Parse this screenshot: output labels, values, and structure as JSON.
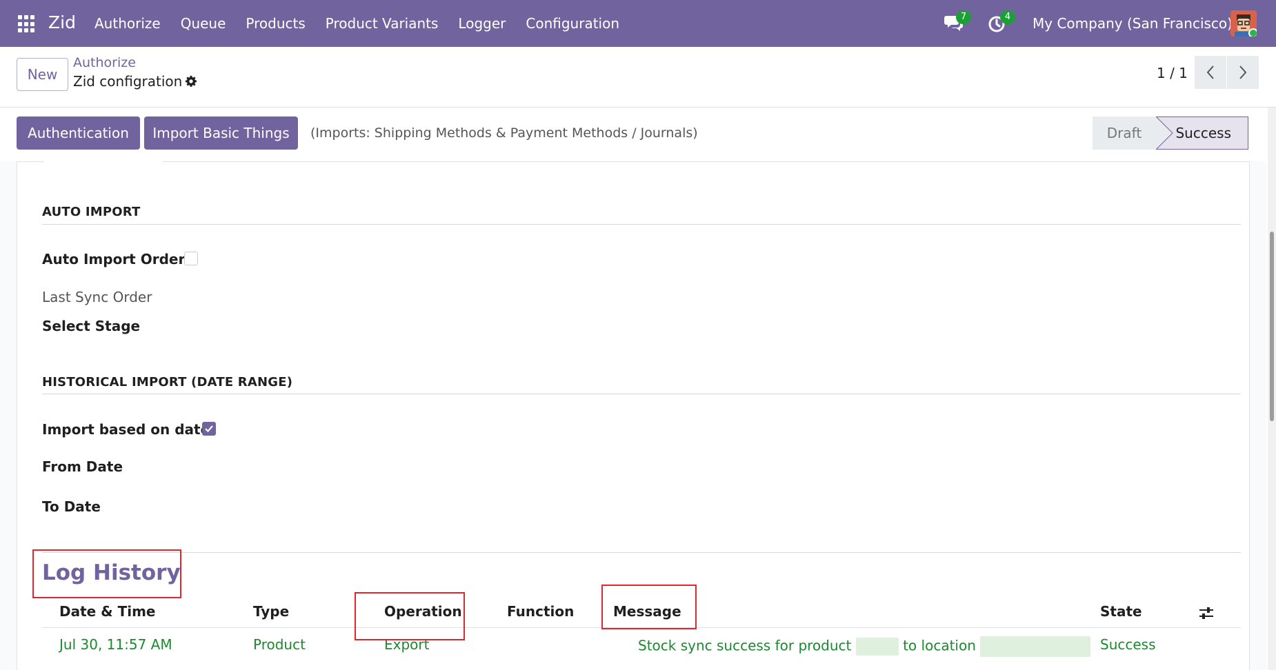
{
  "navbar": {
    "brand": "Zid",
    "menu": [
      "Authorize",
      "Queue",
      "Products",
      "Product Variants",
      "Logger",
      "Configuration"
    ],
    "messages_count": "7",
    "activities_count": "4",
    "company": "My Company (San Francisco)",
    "icons": [
      "apps-grid-icon",
      "chat-icon",
      "clock-icon",
      "avatar"
    ]
  },
  "control": {
    "new_label": "New",
    "breadcrumb_parent": "Authorize",
    "breadcrumb_current": "Zid configration",
    "pager": "1 / 1"
  },
  "statusbar": {
    "auth_button": "Authentication",
    "import_button": "Import Basic Things",
    "imports_note": "(Imports: Shipping Methods & Payment Methods / Journals)",
    "stages": [
      "Draft",
      "Success"
    ],
    "current_stage": "Success"
  },
  "form": {
    "auto_import_title": "AUTO IMPORT",
    "auto_import_order_label": "Auto Import Order",
    "auto_import_order_checked": false,
    "last_sync_order_label": "Last Sync Order",
    "select_stage_label": "Select Stage",
    "historical_title": "HISTORICAL IMPORT (DATE RANGE)",
    "import_based_on_date_label": "Import based on date",
    "import_based_on_date_checked": true,
    "from_date_label": "From Date",
    "to_date_label": "To Date"
  },
  "log": {
    "title": "Log History",
    "columns": [
      "Date & Time",
      "Type",
      "Operation",
      "Function",
      "Message",
      "State"
    ],
    "rows": [
      {
        "datetime": "Jul 30, 11:57 AM",
        "type": "Product",
        "operation": "Export",
        "function": "",
        "message_prefix": "Stock sync success for product",
        "message_middle": "to location",
        "state": "Success"
      }
    ]
  },
  "colors": {
    "brand": "#71639e",
    "success_text": "#1a8a2e",
    "highlight_box": "#e0262d"
  }
}
